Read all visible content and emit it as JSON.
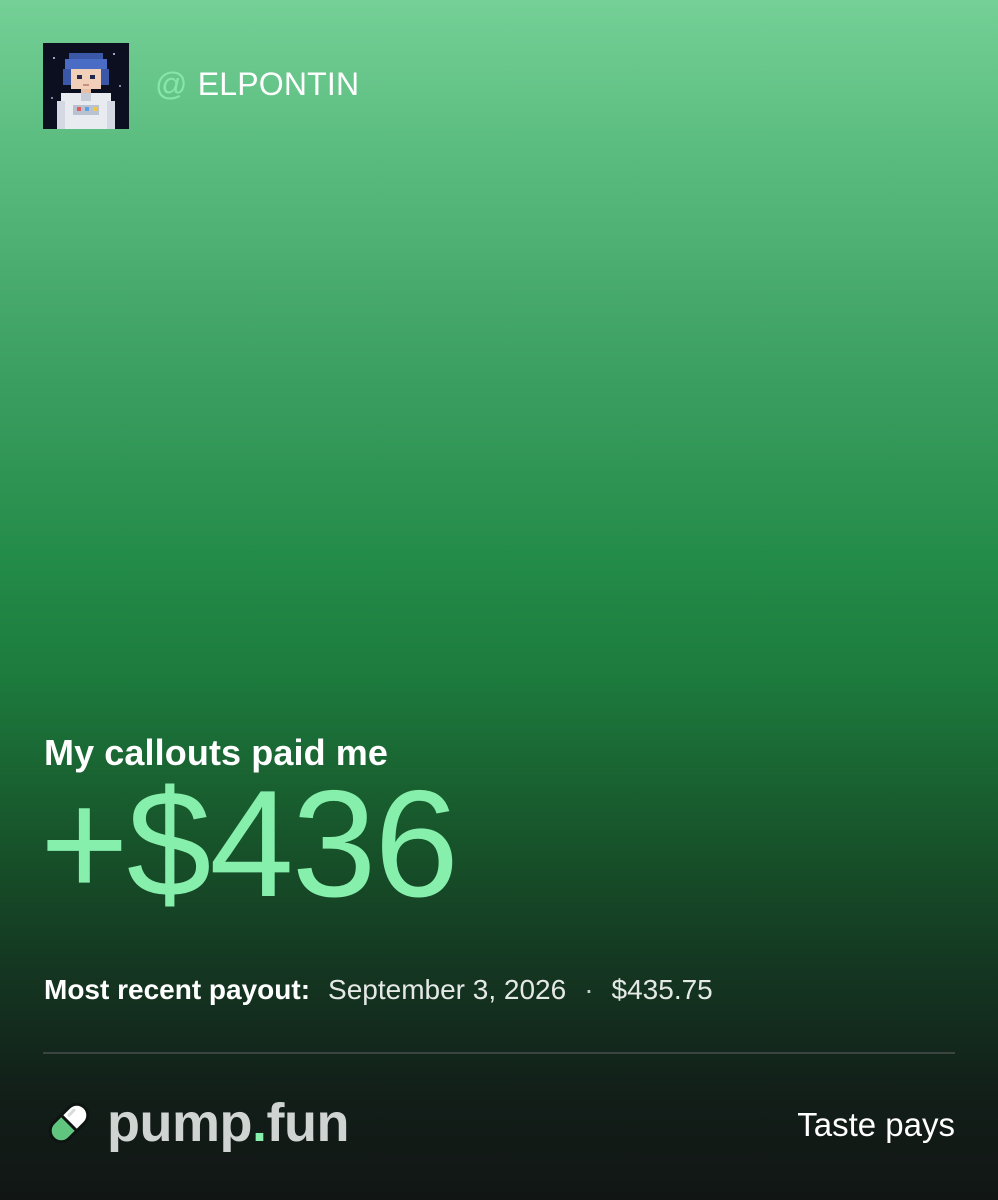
{
  "profile": {
    "at_symbol": "@",
    "username": "ELPONTIN",
    "avatar_icon": "pixel-astronaut-avatar"
  },
  "stats": {
    "headline": "My callouts paid me",
    "amount": "+$436",
    "payout_label": "Most recent payout:",
    "payout_date": "September 3, 2026",
    "separator": "·",
    "payout_amount": "$435.75"
  },
  "footer": {
    "brand_name": "pump",
    "brand_dot": ".",
    "brand_suffix": "fun",
    "brand_icon": "pill-icon",
    "tagline": "Taste pays"
  },
  "colors": {
    "accent": "#86efac",
    "gradient_top": "#74d096",
    "gradient_mid": "#1d7c3e",
    "gradient_bottom": "#111614"
  }
}
